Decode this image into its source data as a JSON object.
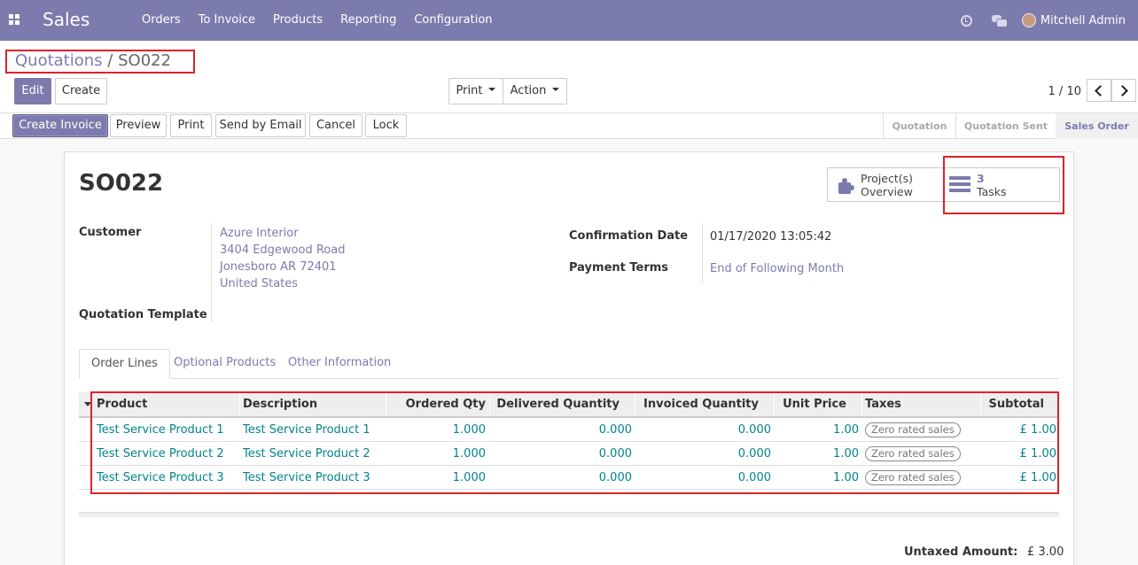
{
  "navbar": {
    "app_name": "Sales",
    "menu": [
      "Orders",
      "To Invoice",
      "Products",
      "Reporting",
      "Configuration"
    ],
    "user": "Mitchell Admin"
  },
  "control_panel": {
    "breadcrumb_parent": "Quotations",
    "breadcrumb_sep": "/",
    "breadcrumb_current": "SO022",
    "edit_label": "Edit",
    "create_label": "Create",
    "print_label": "Print",
    "action_label": "Action",
    "pager": "1 / 10"
  },
  "statusbar": {
    "buttons": [
      "Create Invoice",
      "Preview",
      "Print",
      "Send by Email",
      "Cancel",
      "Lock"
    ],
    "stages": [
      "Quotation",
      "Quotation Sent",
      "Sales Order"
    ],
    "current_stage": "Sales Order"
  },
  "form": {
    "title": "SO022",
    "smart_buttons": {
      "project_line1": "Project(s)",
      "project_line2": "Overview",
      "tasks_count": "3",
      "tasks_label": "Tasks"
    },
    "customer_label": "Customer",
    "customer_lines": [
      "Azure Interior",
      "3404 Edgewood Road",
      "Jonesboro AR 72401",
      "United States"
    ],
    "template_label": "Quotation Template",
    "confirmation_label": "Confirmation Date",
    "confirmation_value": "01/17/2020 13:05:42",
    "payment_label": "Payment Terms",
    "payment_value": "End of Following Month"
  },
  "tabs": [
    "Order Lines",
    "Optional Products",
    "Other Information"
  ],
  "order_lines": {
    "columns": [
      "Product",
      "Description",
      "Ordered Qty",
      "Delivered Quantity",
      "Invoiced Quantity",
      "Unit Price",
      "Taxes",
      "Subtotal"
    ],
    "rows": [
      {
        "product": "Test Service Product 1",
        "description": "Test Service Product 1",
        "ordered": "1.000",
        "delivered": "0.000",
        "invoiced": "0.000",
        "unit_price": "1.00",
        "tax": "Zero rated sales",
        "subtotal": "£ 1.00"
      },
      {
        "product": "Test Service Product 2",
        "description": "Test Service Product 2",
        "ordered": "1.000",
        "delivered": "0.000",
        "invoiced": "0.000",
        "unit_price": "1.00",
        "tax": "Zero rated sales",
        "subtotal": "£ 1.00"
      },
      {
        "product": "Test Service Product 3",
        "description": "Test Service Product 3",
        "ordered": "1.000",
        "delivered": "0.000",
        "invoiced": "0.000",
        "unit_price": "1.00",
        "tax": "Zero rated sales",
        "subtotal": "£ 1.00"
      }
    ]
  },
  "totals": {
    "untaxed_label": "Untaxed Amount:",
    "untaxed_value": "£ 3.00"
  },
  "colors": {
    "brand": "#7c7bad",
    "highlight": "#d9232d",
    "link": "#00848a"
  }
}
